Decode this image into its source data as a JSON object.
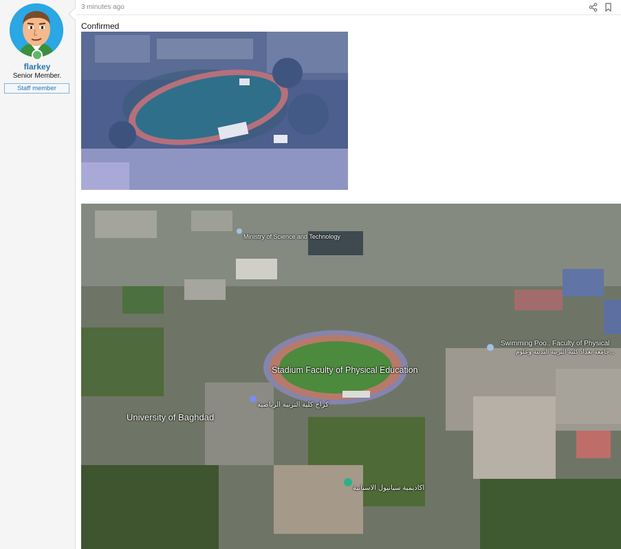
{
  "user": {
    "name": "flarkey",
    "title": "Senior Member.",
    "badge": "Staff member"
  },
  "post": {
    "timestamp": "3 minutes ago",
    "text": "Confirmed",
    "icons": [
      "share-icon",
      "bookmark-icon"
    ]
  },
  "map_labels": {
    "ministry": "Ministry of Science and Technology",
    "stadium": "Stadium Faculty of Physical Education",
    "stadium_ar": "كراج كلية التربية الرياضية",
    "university": "University of Baghdad",
    "swimming": "Swimming Poo.. Faculty of Physical",
    "swimming_ar": "جامعة بغداد كلية التربية البدنية وعلوم...",
    "academy_ar": "اكاديمية سيانيول الاسبانية"
  },
  "colors": {
    "username": "#2577b1",
    "sidebar_bg": "#f5f5f5",
    "badge_border": "#8aafd0"
  }
}
